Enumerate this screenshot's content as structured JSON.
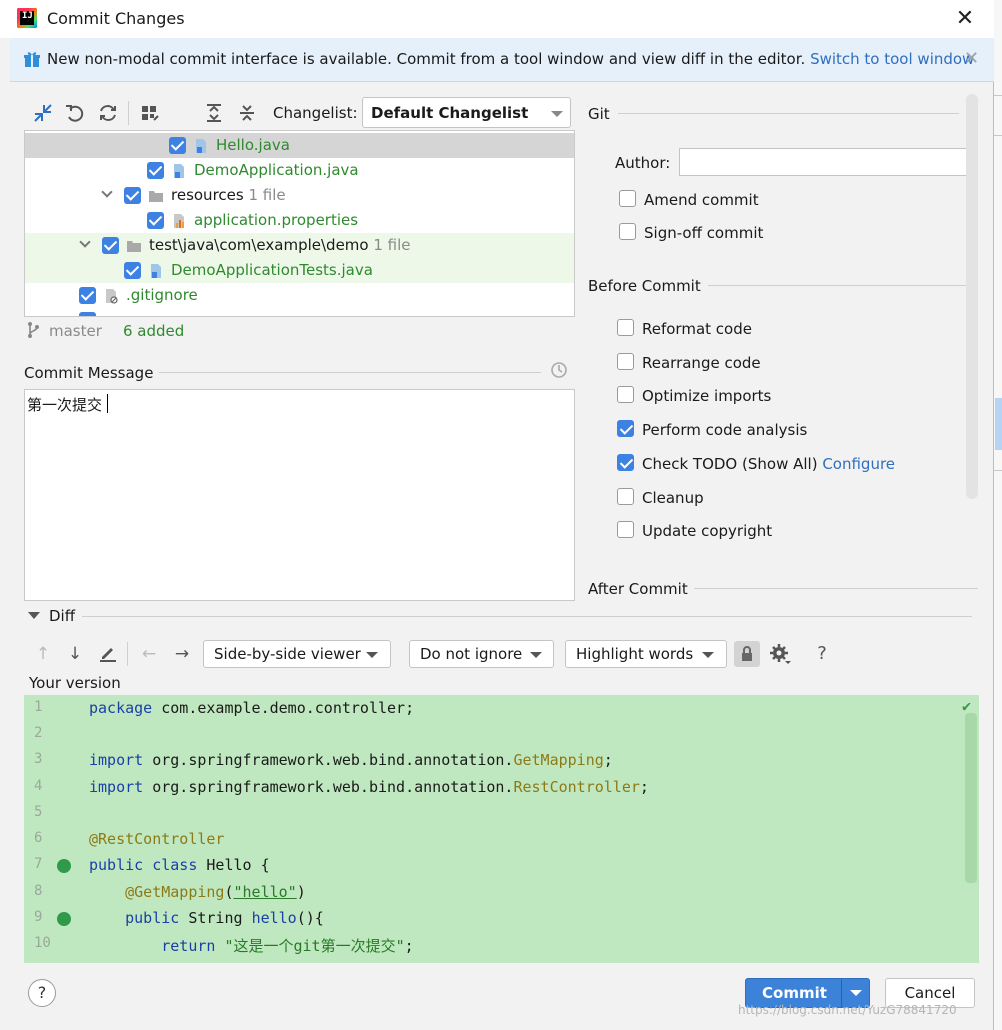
{
  "window": {
    "title": "Commit Changes",
    "close_glyph": "✕"
  },
  "banner": {
    "message": "New non-modal commit interface is available. Commit from a tool window and view diff in the editor.",
    "link": "Switch to tool window",
    "close_glyph": "✕"
  },
  "toolbar": {
    "changelist_label": "Changelist:",
    "changelist_value": "Default Changelist",
    "icons": [
      "collapse-icon",
      "undo-icon",
      "refresh-icon",
      "group-icon",
      "expand-all-icon",
      "collapse-all-icon"
    ]
  },
  "tree": {
    "items": [
      {
        "name": "Hello.java",
        "count": ""
      },
      {
        "name": "DemoApplication.java",
        "count": ""
      },
      {
        "name": "resources",
        "count": "1 file"
      },
      {
        "name": "application.properties",
        "count": ""
      },
      {
        "name": "test\\java\\com\\example\\demo",
        "count": "1 file"
      },
      {
        "name": "DemoApplicationTests.java",
        "count": ""
      },
      {
        "name": ".gitignore",
        "count": ""
      }
    ]
  },
  "status": {
    "branch": "master",
    "added": "6 added"
  },
  "commit_message": {
    "label": "Commit Message",
    "text": "第一次提交"
  },
  "git": {
    "section": "Git",
    "author_label": "Author:",
    "author_value": "",
    "amend": "Amend commit",
    "signoff": "Sign-off commit"
  },
  "before_commit": {
    "section": "Before Commit",
    "options": [
      {
        "label": "Reformat code",
        "checked": false
      },
      {
        "label": "Rearrange code",
        "checked": false
      },
      {
        "label": "Optimize imports",
        "checked": false
      },
      {
        "label": "Perform code analysis",
        "checked": true
      },
      {
        "label": "Check TODO (Show All)",
        "checked": true,
        "link": "Configure"
      },
      {
        "label": "Cleanup",
        "checked": false
      },
      {
        "label": "Update copyright",
        "checked": false
      }
    ]
  },
  "after_commit": {
    "section": "After Commit"
  },
  "diff": {
    "label": "Diff",
    "viewer": "Side-by-side viewer",
    "ignore": "Do not ignore",
    "highlight": "Highlight words",
    "help_glyph": "?",
    "your_version": "Your version",
    "line_numbers": [
      "1",
      "2",
      "3",
      "4",
      "5",
      "6",
      "7",
      "8",
      "9",
      "10"
    ],
    "code": {
      "l1a": "package",
      "l1b": " com.example.demo.controller;",
      "l3a": "import",
      "l3b": " org.springframework.web.bind.annotation.",
      "l3c": "GetMapping",
      "l3d": ";",
      "l4a": "import",
      "l4b": " org.springframework.web.bind.annotation.",
      "l4c": "RestController",
      "l4d": ";",
      "l6": "@RestController",
      "l7a": "public class",
      "l7b": " Hello {",
      "l8a": "    @GetMapping",
      "l8b": "(",
      "l8c": "\"hello\"",
      "l8d": ")",
      "l9a": "    public",
      "l9b": " String ",
      "l9c": "hello",
      "l9d": "(){",
      "l10a": "        return",
      "l10b": " ",
      "l10c": "\"这是一个git第一次提交\"",
      "l10d": ";"
    }
  },
  "buttons": {
    "help": "?",
    "commit": "Commit",
    "cancel": "Cancel"
  },
  "watermark": "https://blog.csdn.net/YuzG78841720",
  "colors": {
    "accent": "#3d82e3",
    "link": "#2f6fbf",
    "added_text": "#2f8a2f",
    "diff_bg": "#c0e8c0"
  }
}
